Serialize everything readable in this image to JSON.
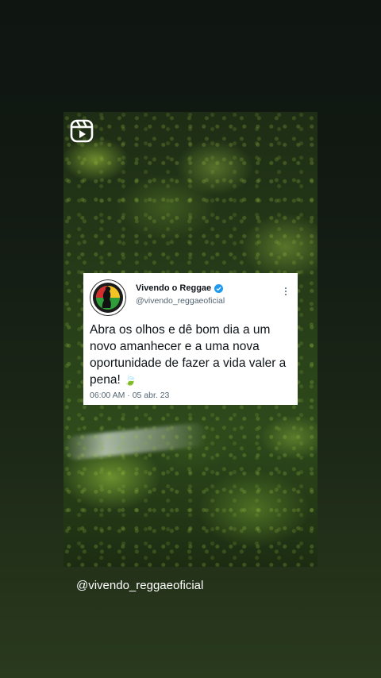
{
  "tweet": {
    "name": "Vivendo o Reggae",
    "handle": "@vivendo_reggaeoficial",
    "text": "Abra os olhos e dê bom dia a um novo amanhecer e a uma nova oportunidade de fazer a vida valer a pena!",
    "emoji": "🍃",
    "timestamp": "06:00 AM · 05 abr. 23"
  },
  "caption": "@vivendo_reggaeoficial",
  "icons": {
    "reels": "reels-icon",
    "verified": "verified-badge-icon",
    "more": "more-vertical-icon",
    "avatar": "vivendo-o-reggae-logo"
  },
  "colors": {
    "verified": "#1d9bf0",
    "reggae_red": "#d32f2f",
    "reggae_yellow": "#f6c324",
    "reggae_green": "#2e9d3a"
  }
}
